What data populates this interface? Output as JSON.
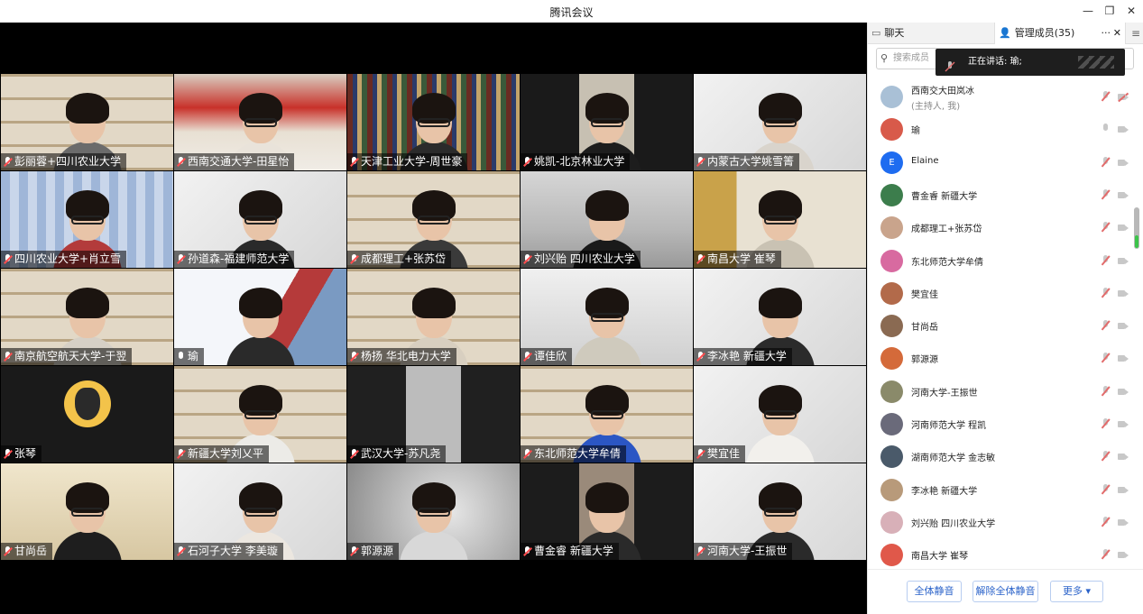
{
  "window": {
    "title": "腾讯会议",
    "controls": [
      "minimize",
      "restore",
      "close"
    ]
  },
  "grid": {
    "tiles": [
      {
        "name": "彭丽蓉+四川农业大学",
        "muted": true,
        "bg": "shelves",
        "shirt": "#6b6b6b",
        "glasses": false
      },
      {
        "name": "西南交通大学-田星怡",
        "muted": true,
        "bg": "poster",
        "shirt": "#e9e3da",
        "glasses": true
      },
      {
        "name": "天津工业大学-周世豪",
        "muted": true,
        "bg": "books",
        "shirt": "#2b2b2b",
        "glasses": true
      },
      {
        "name": "姚凯-北京林业大学",
        "muted": true,
        "bg": "dark",
        "shirt": "#1d1d1d",
        "glasses": true
      },
      {
        "name": "内蒙古大学姚雪箐",
        "muted": true,
        "bg": "white",
        "shirt": "#d9d4cc",
        "glasses": true
      },
      {
        "name": "四川农业大学+肖立雪",
        "muted": true,
        "bg": "curtain",
        "shirt": "#b33b3b",
        "glasses": true
      },
      {
        "name": "孙道森-福建师范大学",
        "muted": true,
        "bg": "white",
        "shirt": "#2a2a2a",
        "glasses": true
      },
      {
        "name": "成都理工+张苏岱",
        "muted": true,
        "bg": "shelves",
        "shirt": "#3a3a3a",
        "glasses": true
      },
      {
        "name": "刘兴贻 四川农业大学",
        "muted": true,
        "bg": "dorm",
        "shirt": "#1a1a1a",
        "glasses": false
      },
      {
        "name": "南昌大学 崔琴",
        "muted": true,
        "bg": "curtain2",
        "shirt": "#c9c2b3",
        "glasses": true
      },
      {
        "name": "南京航空航天大学-于翌",
        "muted": true,
        "bg": "shelves",
        "shirt": "#d6d0c6",
        "glasses": false
      },
      {
        "name": "瑜",
        "muted": false,
        "bg": "banner",
        "shirt": "#2a2a2a",
        "glasses": false
      },
      {
        "name": "杨扬  华北电力大学",
        "muted": true,
        "bg": "shelves",
        "shirt": "#d8cfc0",
        "glasses": false
      },
      {
        "name": "谭佳欣",
        "muted": true,
        "bg": "lamp",
        "shirt": "#cfcabd",
        "glasses": true
      },
      {
        "name": "李冰艳 新疆大学",
        "muted": true,
        "bg": "white",
        "shirt": "#2b2b2b",
        "glasses": false
      },
      {
        "name": "张琴",
        "muted": true,
        "bg": "avatar",
        "shirt": "",
        "glasses": false
      },
      {
        "name": "新疆大学刘乂平",
        "muted": true,
        "bg": "shelves",
        "shirt": "#ecebe7",
        "glasses": true
      },
      {
        "name": "武汉大学-苏凡尧",
        "muted": true,
        "bg": "dark2",
        "shirt": "",
        "glasses": false
      },
      {
        "name": "东北师范大学牟倩",
        "muted": true,
        "bg": "shelves",
        "shirt": "#2b56c4",
        "glasses": true
      },
      {
        "name": "樊宜佳",
        "muted": true,
        "bg": "white",
        "shirt": "#f2f0ec",
        "glasses": true
      },
      {
        "name": "甘尚岳",
        "muted": true,
        "bg": "warm",
        "shirt": "#1e1e1e",
        "glasses": true
      },
      {
        "name": "石河子大学 李美璇",
        "muted": true,
        "bg": "white",
        "shirt": "#ece7e0",
        "glasses": true
      },
      {
        "name": "郭源源",
        "muted": true,
        "bg": "blur",
        "shirt": "#d8d8d8",
        "glasses": true
      },
      {
        "name": "曹金睿 新疆大学",
        "muted": true,
        "bg": "dark3",
        "shirt": "#2a2a2a",
        "glasses": false
      },
      {
        "name": "河南大学-王振世",
        "muted": true,
        "bg": "white",
        "shirt": "#2a2a2a",
        "glasses": true
      }
    ]
  },
  "panel": {
    "tab_chat": "聊天",
    "tab_members": "管理成员(35)",
    "tab_more": "···",
    "search_placeholder": "搜索成员",
    "speaking_label": "正在讲话: 瑜;",
    "members": [
      {
        "name": "西南交大田岚冰",
        "sub": "(主持人, 我)",
        "avatar": "#a9c0d6",
        "initial": "",
        "mic_muted": true,
        "cam_off": true
      },
      {
        "name": "瑜",
        "sub": "",
        "avatar": "#d85a4a",
        "initial": "",
        "mic_muted": false,
        "cam_off": false
      },
      {
        "name": "Elaine",
        "sub": "",
        "avatar": "#1e6cf0",
        "initial": "E",
        "mic_muted": true,
        "cam_off": false
      },
      {
        "name": "曹金睿 新疆大学",
        "sub": "",
        "avatar": "#3c7d4c",
        "initial": "",
        "mic_muted": true,
        "cam_off": false
      },
      {
        "name": "成都理工+张苏岱",
        "sub": "",
        "avatar": "#c9a48c",
        "initial": "",
        "mic_muted": true,
        "cam_off": false
      },
      {
        "name": "东北师范大学牟倩",
        "sub": "",
        "avatar": "#d86aa0",
        "initial": "",
        "mic_muted": true,
        "cam_off": false
      },
      {
        "name": "樊宜佳",
        "sub": "",
        "avatar": "#b26a4a",
        "initial": "",
        "mic_muted": true,
        "cam_off": false
      },
      {
        "name": "甘尚岳",
        "sub": "",
        "avatar": "#8a6a52",
        "initial": "",
        "mic_muted": true,
        "cam_off": false
      },
      {
        "name": "郭源源",
        "sub": "",
        "avatar": "#d46a3a",
        "initial": "",
        "mic_muted": true,
        "cam_off": false
      },
      {
        "name": "河南大学-王振世",
        "sub": "",
        "avatar": "#8a8a6a",
        "initial": "",
        "mic_muted": true,
        "cam_off": false
      },
      {
        "name": "河南师范大学 程凯",
        "sub": "",
        "avatar": "#6a6a7a",
        "initial": "",
        "mic_muted": true,
        "cam_off": false
      },
      {
        "name": "湖南师范大学 金志敏",
        "sub": "",
        "avatar": "#4a5a6a",
        "initial": "",
        "mic_muted": true,
        "cam_off": false
      },
      {
        "name": "李冰艳 新疆大学",
        "sub": "",
        "avatar": "#b89a7a",
        "initial": "",
        "mic_muted": true,
        "cam_off": false
      },
      {
        "name": "刘兴贻 四川农业大学",
        "sub": "",
        "avatar": "#d8b0b8",
        "initial": "",
        "mic_muted": true,
        "cam_off": false
      },
      {
        "name": "南昌大学 崔琴",
        "sub": "",
        "avatar": "#e0584a",
        "initial": "",
        "mic_muted": true,
        "cam_off": false
      }
    ],
    "footer": {
      "mute_all": "全体静音",
      "unmute_all": "解除全体静音",
      "more": "更多 ▾"
    }
  },
  "colors": {
    "accent": "#2a62c9",
    "muted_red": "#e26b6b",
    "active_green": "#30c95a"
  }
}
